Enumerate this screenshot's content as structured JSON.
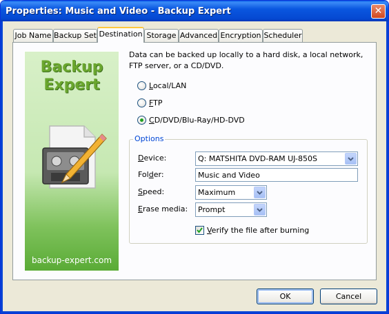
{
  "window": {
    "title": "Properties: Music and Video - Backup Expert",
    "close_icon": "close-icon"
  },
  "tabs": [
    {
      "label": "Job Name"
    },
    {
      "label": "Backup Set"
    },
    {
      "label": "Destination",
      "active": true
    },
    {
      "label": "Storage"
    },
    {
      "label": "Advanced"
    },
    {
      "label": "Encryption"
    },
    {
      "label": "Scheduler"
    }
  ],
  "banner": {
    "title": "Backup Expert",
    "url": "backup-expert.com",
    "art_icon": "tape-drive-with-pencil-icon"
  },
  "destination": {
    "description": "Data can be backed up locally to a hard disk, a local network, FTP server, or a CD/DVD.",
    "options": [
      {
        "prefix": "",
        "mnemonic": "L",
        "rest": "ocal/LAN",
        "selected": false
      },
      {
        "prefix": "",
        "mnemonic": "F",
        "rest": "TP",
        "selected": false
      },
      {
        "prefix": "",
        "mnemonic": "C",
        "rest": "D/DVD/Blu-Ray/HD-DVD",
        "selected": true
      }
    ]
  },
  "options_group": {
    "legend": "Options",
    "device": {
      "mnemonic": "D",
      "rest": "evice:",
      "value": "Q: MATSHITA DVD-RAM UJ-850S"
    },
    "folder": {
      "prefix": "Fol",
      "mnemonic": "d",
      "rest": "er:",
      "value": "Music and Video"
    },
    "speed": {
      "mnemonic": "S",
      "rest": "peed:",
      "value": "Maximum"
    },
    "erase": {
      "mnemonic": "E",
      "rest": "rase media:",
      "value": "Prompt"
    },
    "verify": {
      "mnemonic": "V",
      "rest": "erify the file after burning",
      "checked": true
    }
  },
  "buttons": {
    "ok": "OK",
    "cancel": "Cancel"
  },
  "colors": {
    "titlebar": "#0a57e0",
    "tab_highlight": "#ffc83c",
    "group_legend": "#0046d5",
    "radio_dot": "#21a121"
  }
}
